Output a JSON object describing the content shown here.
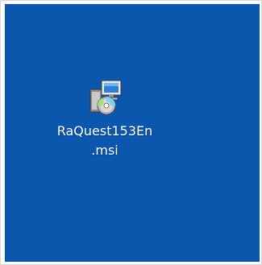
{
  "desktop": {
    "background_color": "#0a57ad",
    "icon": {
      "icon_name": "msi-installer-icon",
      "label_line1": "RaQuest153En",
      "label_line2": ".msi"
    }
  }
}
